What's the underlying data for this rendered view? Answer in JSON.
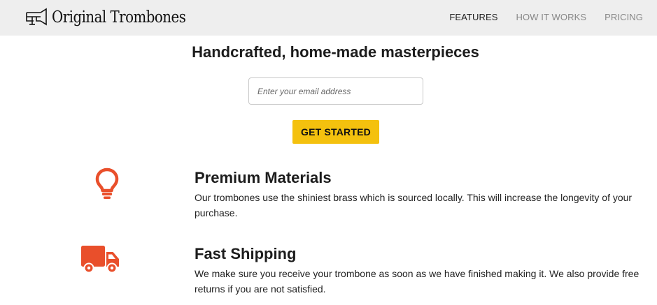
{
  "header": {
    "logo_text": "Original Trombones",
    "logo_icon": "trombone-icon",
    "nav": [
      {
        "label": "FEATURES",
        "active": true
      },
      {
        "label": "HOW IT WORKS",
        "active": false
      },
      {
        "label": "PRICING",
        "active": false
      }
    ]
  },
  "hero": {
    "title": "Handcrafted, home-made masterpieces",
    "email_placeholder": "Enter your email address",
    "cta_label": "GET STARTED"
  },
  "features": [
    {
      "icon": "lightbulb-icon",
      "title": "Premium Materials",
      "description": "Our trombones use the shiniest brass which is sourced locally. This will increase the longevity of your purchase."
    },
    {
      "icon": "truck-icon",
      "title": "Fast Shipping",
      "description": "We make sure you receive your trombone as soon as we have finished making it. We also provide free returns if you are not satisfied."
    }
  ],
  "colors": {
    "header_bg": "#eeeeee",
    "accent_icon": "#e94f2b",
    "cta_bg": "#f4c10e"
  }
}
